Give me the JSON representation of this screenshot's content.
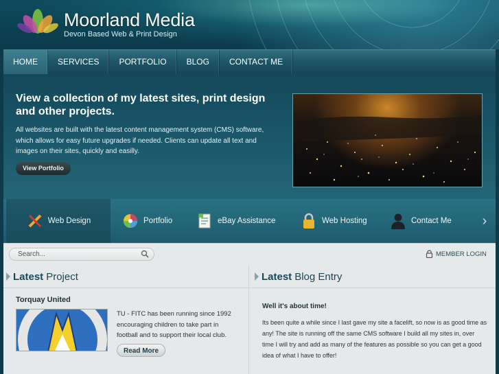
{
  "site": {
    "title": "Moorland Media",
    "tagline": "Devon Based Web & Print Design"
  },
  "nav": {
    "items": [
      "HOME",
      "SERVICES",
      "PORTFOLIO",
      "BLOG",
      "CONTACT ME"
    ]
  },
  "hero": {
    "title": "View a collection of my latest sites, print design and other projects.",
    "text": "All websites are built with the latest content management system (CMS) software, which allows for easy future upgrades if needed. Clients can update all text and images on their sites, quickly and easilly.",
    "button": "View Portfolio"
  },
  "carousel": {
    "items": [
      {
        "label": "Web Design",
        "icon": "pencil-ruler-icon"
      },
      {
        "label": "Portfolio",
        "icon": "color-wheel-icon"
      },
      {
        "label": "eBay Assistance",
        "icon": "document-icon"
      },
      {
        "label": "Web Hosting",
        "icon": "padlock-icon"
      },
      {
        "label": "Contact Me",
        "icon": "person-icon"
      }
    ]
  },
  "search": {
    "placeholder": "Search..."
  },
  "member_login": "MEMBER LOGIN",
  "project": {
    "head_bold": "Latest",
    "head_rest": "Project",
    "title": "Torquay United",
    "text": "TU - FITC has been running since 1992 encouraging children to take part in football and to support their local club.",
    "button": "Read More"
  },
  "blog": {
    "head_bold": "Latest",
    "head_rest": "Blog Entry",
    "title": "Well it's about time!",
    "text": "Its been quite a while since I last gave my site a facelift, so now is as good time as any! The site is running off the same CMS software I build all my sites in, over time I will try and add as many of the features as possible so you can get a good idea of what I have to offer!"
  },
  "colors": {
    "accent": "#1c5c6d",
    "header": "#0c3b4b",
    "panel": "#e6e9e9"
  }
}
